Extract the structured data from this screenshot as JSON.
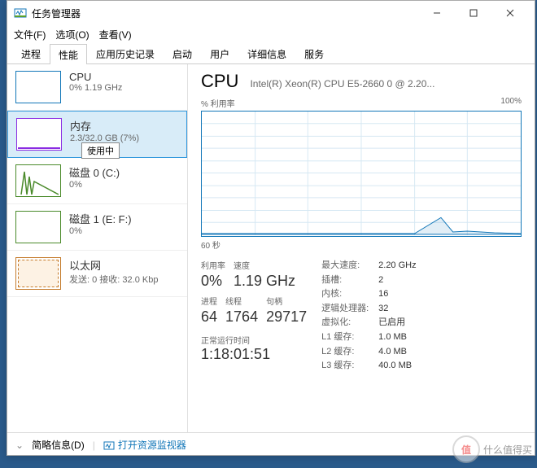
{
  "window": {
    "title": "任务管理器"
  },
  "menu": {
    "file": "文件(F)",
    "options": "选项(O)",
    "view": "查看(V)"
  },
  "tabs": [
    "进程",
    "性能",
    "应用历史记录",
    "启动",
    "用户",
    "详细信息",
    "服务"
  ],
  "active_tab": 1,
  "sidebar": {
    "cpu": {
      "title": "CPU",
      "sub": "0% 1.19 GHz"
    },
    "mem": {
      "title": "内存",
      "sub": "2.3/32.0 GB (7%)",
      "tooltip": "使用中"
    },
    "disk0": {
      "title": "磁盘 0 (C:)",
      "sub": "0%"
    },
    "disk1": {
      "title": "磁盘 1 (E: F:)",
      "sub": "0%"
    },
    "eth": {
      "title": "以太网",
      "sub": "发送: 0 接收: 32.0 Kbp"
    }
  },
  "main": {
    "title": "CPU",
    "model": "Intel(R) Xeon(R) CPU E5-2660 0 @ 2.20...",
    "util_label": "% 利用率",
    "max_label": "100%",
    "time_label": "60 秒",
    "stats": {
      "util_lbl": "利用率",
      "util": "0%",
      "speed_lbl": "速度",
      "speed": "1.19 GHz",
      "proc_lbl": "进程",
      "proc": "64",
      "threads_lbl": "线程",
      "threads": "1764",
      "handles_lbl": "句柄",
      "handles": "29717",
      "uptime_lbl": "正常运行时间",
      "uptime": "1:18:01:51"
    },
    "right": {
      "maxspeed_lbl": "最大速度:",
      "maxspeed": "2.20 GHz",
      "sockets_lbl": "插槽:",
      "sockets": "2",
      "cores_lbl": "内核:",
      "cores": "16",
      "lprocs_lbl": "逻辑处理器:",
      "lprocs": "32",
      "virt_lbl": "虚拟化:",
      "virt": "已启用",
      "l1_lbl": "L1 缓存:",
      "l1": "1.0 MB",
      "l2_lbl": "L2 缓存:",
      "l2": "4.0 MB",
      "l3_lbl": "L3 缓存:",
      "l3": "40.0 MB"
    }
  },
  "footer": {
    "fewer": "简略信息(D)",
    "resmon": "打开资源监视器"
  },
  "watermark": "什么值得买",
  "chart_data": {
    "type": "line",
    "title": "% 利用率",
    "xlabel": "60 秒",
    "ylabel": "",
    "ylim": [
      0,
      100
    ],
    "x": [
      0,
      5,
      10,
      15,
      20,
      25,
      30,
      35,
      40,
      45,
      50,
      55,
      60
    ],
    "series": [
      {
        "name": "CPU 利用率",
        "values": [
          1,
          1,
          1,
          1,
          1,
          1,
          1,
          1,
          1,
          14,
          3,
          2,
          1
        ]
      }
    ]
  }
}
